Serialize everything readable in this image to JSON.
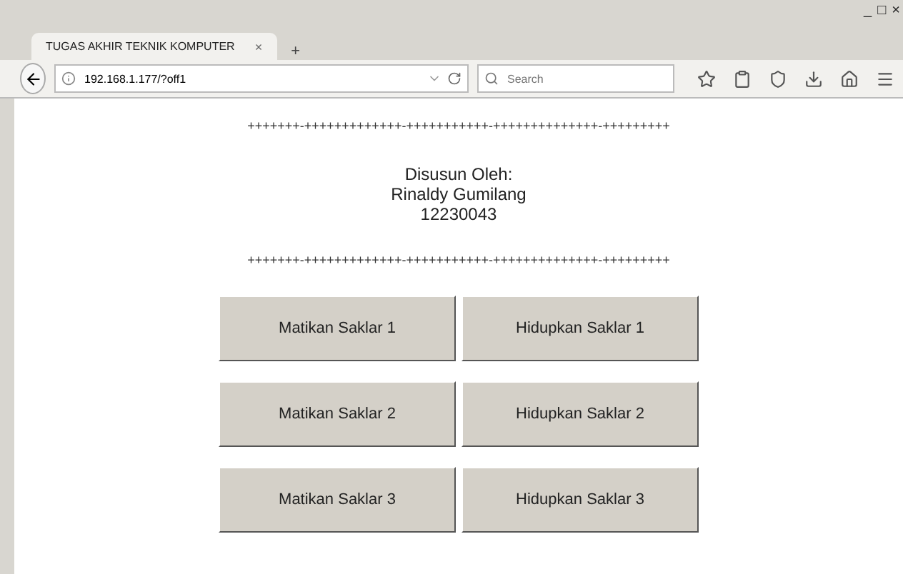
{
  "window": {
    "controls": [
      "_",
      "□",
      "×"
    ]
  },
  "tabs": [
    {
      "label": "TUGAS AKHIR TEKNIK KOMPUTER",
      "close": "×",
      "selected": true
    }
  ],
  "new_tab": "+",
  "address_bar": {
    "value": "192.168.1.177/?off1"
  },
  "search": {
    "placeholder": "Search"
  },
  "page": {
    "rule": "+++++++-+++++++++++++-+++++++++++-++++++++++++++-+++++++++",
    "lines": [
      "Disusun Oleh:",
      "Rinaldy Gumilang",
      "12230043"
    ],
    "buttons": [
      [
        "Matikan Saklar 1",
        "Hidupkan Saklar 1"
      ],
      [
        "Matikan Saklar 2",
        "Hidupkan Saklar 2"
      ],
      [
        "Matikan Saklar 3",
        "Hidupkan Saklar 3"
      ]
    ]
  }
}
